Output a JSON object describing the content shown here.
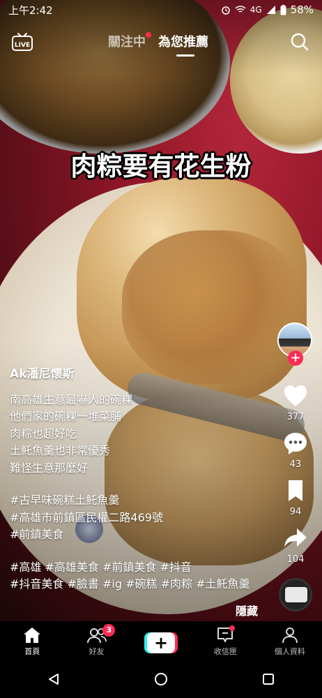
{
  "status_bar": {
    "time": "上午2:42",
    "network": "4G",
    "battery": "58%"
  },
  "top_nav": {
    "live_label": "LIVE",
    "tabs": [
      {
        "label": "關注中",
        "active": false,
        "has_dot": true
      },
      {
        "label": "為您推薦",
        "active": true
      }
    ]
  },
  "video": {
    "caption": "肉粽要有花生粉"
  },
  "actions": {
    "likes": "377",
    "comments": "43",
    "saves": "94",
    "shares": "104"
  },
  "description": {
    "author": "Ak潘尼懷斯",
    "lines": [
      "南高雄生意最嚇人的碗粿",
      "他們家的碗粿一堆菜脯",
      "肉粽也超好吃",
      "土魠魚羹也非常優秀",
      "難怪生意那麼好"
    ],
    "hashtags_block1": [
      "#古早味碗糕土魠魚羹",
      "#高雄市前鎮區民權二路469號",
      "#前鎮美食"
    ],
    "hashtags_block2": [
      "#高雄 #高雄美食 #前鎮美食 #抖音",
      "#抖音美食 #臉書 #ig #碗糕 #肉粽 #土魠魚羹"
    ],
    "hide_label": "隱藏"
  },
  "tab_bar": {
    "home": "首頁",
    "friends": "好友",
    "friends_badge": "3",
    "create": "+",
    "inbox": "收信匣",
    "profile": "個人資料"
  },
  "colors": {
    "accent": "#fe2c55",
    "cyan": "#25f4ee"
  }
}
